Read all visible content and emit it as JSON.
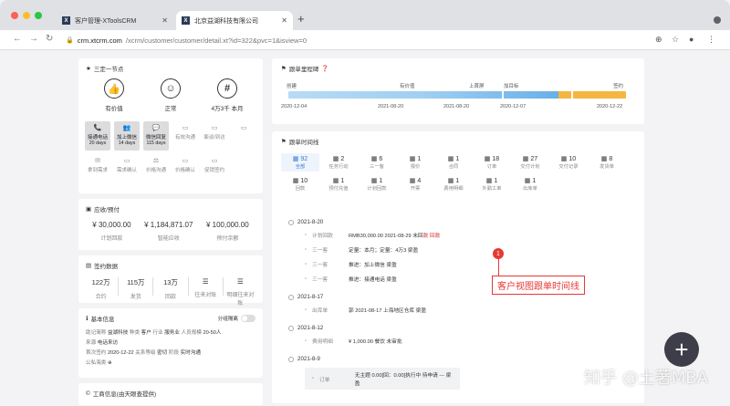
{
  "browser": {
    "tabs": [
      {
        "title": "客户管理-XToolsCRM",
        "favicon": "X"
      },
      {
        "title": "北京益湖科技有限公司",
        "favicon": "X"
      }
    ],
    "url_host": "crm.xtcrm.com",
    "url_path": "/xcrm/customer/customer/detail.xt?id=322&pvc=1&isview=0"
  },
  "summary": {
    "header": "三定一节点",
    "status": [
      {
        "icon": "thumbs-up-icon",
        "glyph": "👍",
        "label": "有价值"
      },
      {
        "icon": "face-icon",
        "glyph": "☺",
        "label": "正常"
      },
      {
        "icon": "hash-icon",
        "glyph": "#",
        "label": "4万3千 本月"
      }
    ],
    "actions": [
      {
        "glyph": "📞",
        "label": "接通电话",
        "sub": "20 days",
        "on": true
      },
      {
        "glyph": "👥",
        "label": "加上微信",
        "sub": "14 days",
        "on": true
      },
      {
        "glyph": "💬",
        "label": "微信回复",
        "sub": "115 days",
        "on": true
      },
      {
        "glyph": "▭",
        "label": "有效沟通",
        "sub": "",
        "on": false
      },
      {
        "glyph": "▭",
        "label": "面谈/到访",
        "sub": "",
        "on": false
      },
      {
        "glyph": "▭",
        "label": "",
        "sub": "",
        "on": false
      },
      {
        "glyph": "✉",
        "label": "拿到需求",
        "sub": "",
        "on": false
      },
      {
        "glyph": "▭",
        "label": "需求确认",
        "sub": "",
        "on": false
      },
      {
        "glyph": "⚖",
        "label": "价格沟通",
        "sub": "",
        "on": false
      },
      {
        "glyph": "▭",
        "label": "价格确认",
        "sub": "",
        "on": false
      },
      {
        "glyph": "▭",
        "label": "促销签约",
        "sub": "",
        "on": false
      }
    ]
  },
  "receivable": {
    "header": "应收/预付",
    "items": [
      {
        "value": "¥ 30,000.00",
        "label": "计划回款"
      },
      {
        "value": "¥ 1,184,871.07",
        "label": "智能应收"
      },
      {
        "value": "¥ 100,000.00",
        "label": "预付余额"
      }
    ]
  },
  "sign": {
    "header": "签约数据",
    "items": [
      {
        "value": "122万",
        "label": "合约"
      },
      {
        "value": "115万",
        "label": "发货"
      },
      {
        "value": "13万",
        "label": "回款"
      },
      {
        "value": "☰",
        "label": "往来对账"
      },
      {
        "value": "☰",
        "label": "明细往来对账"
      }
    ]
  },
  "basic": {
    "header": "基本信息",
    "toggle_label": "分组隔离",
    "lines": [
      [
        [
          "助记简称",
          "益湖科技"
        ],
        [
          "种类",
          "客户"
        ],
        [
          "行业",
          "服务业"
        ],
        [
          "人员规模",
          "20-50人"
        ]
      ],
      [
        [
          "来源",
          "电话来访"
        ]
      ],
      [
        [
          "首次签约",
          "2020-12-22"
        ],
        [
          "关系等级",
          "密切"
        ],
        [
          "阶段",
          "实时沟通"
        ]
      ],
      [
        [
          "公私海类",
          "⊕"
        ]
      ]
    ]
  },
  "business": {
    "header": "工商信息(由天眼查提供)"
  },
  "progress": {
    "header": "跟单里程碑",
    "stages": [
      "创建",
      "有价值",
      "上首屏",
      "加目标",
      "签约"
    ],
    "dates": [
      "2020-12-04",
      "2021-08-20",
      "2021-08-20",
      "2020-12-07",
      "2020-12-22"
    ]
  },
  "timeline": {
    "header": "跟单时间线",
    "categories": [
      {
        "count": "92",
        "label": "全部",
        "selected": true
      },
      {
        "count": "2",
        "label": "任务行动",
        "selected": false
      },
      {
        "count": "6",
        "label": "三一客",
        "selected": false
      },
      {
        "count": "1",
        "label": "报价",
        "selected": false
      },
      {
        "count": "1",
        "label": "合同",
        "selected": false
      },
      {
        "count": "18",
        "label": "订单",
        "selected": false
      },
      {
        "count": "27",
        "label": "交付计划",
        "selected": false
      },
      {
        "count": "10",
        "label": "交付记录",
        "selected": false
      },
      {
        "count": "8",
        "label": "发货单",
        "selected": false
      },
      {
        "count": "10",
        "label": "回款",
        "selected": false
      },
      {
        "count": "1",
        "label": "预付充值",
        "selected": false
      },
      {
        "count": "1",
        "label": "计划回款",
        "selected": false
      },
      {
        "count": "4",
        "label": "开票",
        "selected": false
      },
      {
        "count": "1",
        "label": "费用明细",
        "selected": false
      },
      {
        "count": "1",
        "label": "外勤工单",
        "selected": false
      },
      {
        "count": "1",
        "label": "出库单",
        "selected": false
      }
    ],
    "days": [
      {
        "date": "2021-8-20",
        "events": [
          {
            "type": "计划回款",
            "text": "RMB30,000.00 2021-08-29 未回",
            "red": "款",
            "tail": " 回款"
          },
          {
            "type": "三一客",
            "text": "定量：本月；定量：4万3 梁盈"
          },
          {
            "type": "三一客",
            "text": "推进：加上微信 梁盈"
          },
          {
            "type": "三一客",
            "text": "推进：接通电话 梁盈"
          }
        ]
      },
      {
        "date": "2021-8-17",
        "events": [
          {
            "type": "出库单",
            "text": "郭 2021-08-17 上海地区仓库 梁盈"
          }
        ]
      },
      {
        "date": "2021-8-12",
        "events": [
          {
            "type": "费用明细",
            "text": "¥ 1,000.00 餐饮 未审批"
          }
        ]
      },
      {
        "date": "2021-8-9",
        "events": [
          {
            "type": "订单",
            "text": "无主题 0.00[回：0.00]执行中 待申请 --- 梁盈"
          }
        ]
      }
    ]
  },
  "annotation": {
    "badge": "1",
    "text": "客户视图跟单时间线"
  },
  "fab_label": "+",
  "watermark": "知乎 @土著MBA"
}
